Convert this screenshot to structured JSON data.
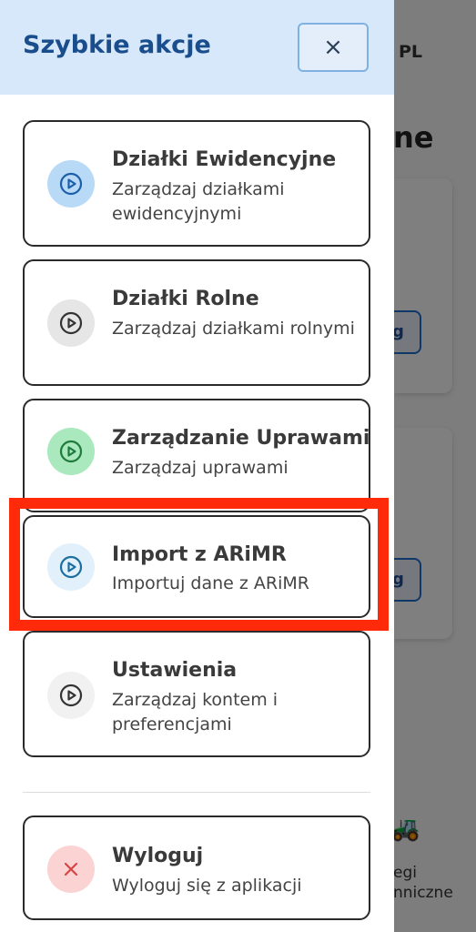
{
  "background": {
    "lang": "PL",
    "heading_fragment": "ne",
    "button_fragment_1": "g",
    "button_fragment_2": "g",
    "nav_text_1": "egi",
    "nav_text_2": "nniczne"
  },
  "drawer": {
    "title": "Szybkie akcje",
    "close_glyph": "×",
    "items": [
      {
        "title": "Działki Ewidencyjne",
        "subtitle": "Zarządzaj działkami ewidencyjnymi",
        "icon": "play-circle-icon",
        "icon_bg": "#b9daf7",
        "icon_color": "#1c5fa8"
      },
      {
        "title": "Działki Rolne",
        "subtitle": "Zarządzaj działkami rolnymi",
        "icon": "play-circle-icon",
        "icon_bg": "#e6e6e6",
        "icon_color": "#333333"
      },
      {
        "title": "Zarządzanie Uprawami",
        "subtitle": "Zarządzaj uprawami",
        "icon": "play-circle-icon",
        "icon_bg": "#a9e9bd",
        "icon_color": "#1f7a3c"
      },
      {
        "title": "Import z ARiMR",
        "subtitle": "Importuj dane z ARiMR",
        "icon": "play-circle-icon",
        "icon_bg": "#e1f0fb",
        "icon_color": "#1a6f9f"
      },
      {
        "title": "Ustawienia",
        "subtitle": "Zarządzaj kontem i preferencjami",
        "icon": "play-circle-icon",
        "icon_bg": "#f1f1f1",
        "icon_color": "#333333"
      }
    ],
    "logout": {
      "title": "Wyloguj",
      "subtitle": "Wyloguj się z aplikacji",
      "icon": "close-icon",
      "icon_bg": "#fbd3d3",
      "icon_color": "#d64545"
    }
  },
  "highlight_color": "#ff2a0a"
}
